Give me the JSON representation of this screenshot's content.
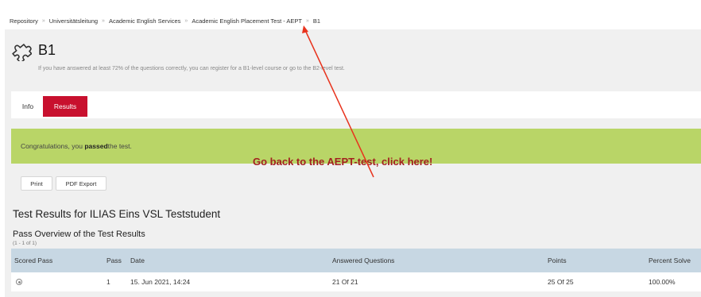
{
  "breadcrumb": {
    "items": [
      {
        "label": "Repository"
      },
      {
        "label": "Universitätsleitung"
      },
      {
        "label": "Academic English Services"
      },
      {
        "label": "Academic English Placement Test - AEPT"
      },
      {
        "label": "B1"
      }
    ],
    "separator": "»"
  },
  "header": {
    "icon": "puzzle-icon",
    "title": "B1",
    "description": "If you have answered at least 72% of the questions correctly, you can register for a B1-level course or go to the B2-level test."
  },
  "tabs": [
    {
      "label": "Info",
      "active": false
    },
    {
      "label": "Results",
      "active": true
    }
  ],
  "message": {
    "prefix": "Congratulations, you ",
    "bold": "passed",
    "suffix": " the test."
  },
  "toolbar": {
    "print_label": "Print",
    "pdf_label": "PDF Export"
  },
  "annotation": {
    "text": "Go back to the AEPT-test, click here!",
    "color": "#a32020"
  },
  "results": {
    "heading": "Test Results for ILIAS Eins VSL Teststudent",
    "pass_overview": "Pass Overview of the Test Results",
    "range": "(1 - 1 of 1)",
    "columns": [
      "Scored Pass",
      "Pass",
      "Date",
      "Answered Questions",
      "Points",
      "Percent Solve"
    ],
    "rows": [
      {
        "scored_icon": "radio-icon",
        "pass": "1",
        "date": "15. Jun 2021, 14:24",
        "answered": "21 Of 21",
        "points": "25 Of 25",
        "percent": "100.00%"
      }
    ]
  },
  "colors": {
    "accent_tab": "#c8102e",
    "success_bg": "#b9d567",
    "table_header": "#c7d7e3",
    "arrow": "#e8331d"
  }
}
